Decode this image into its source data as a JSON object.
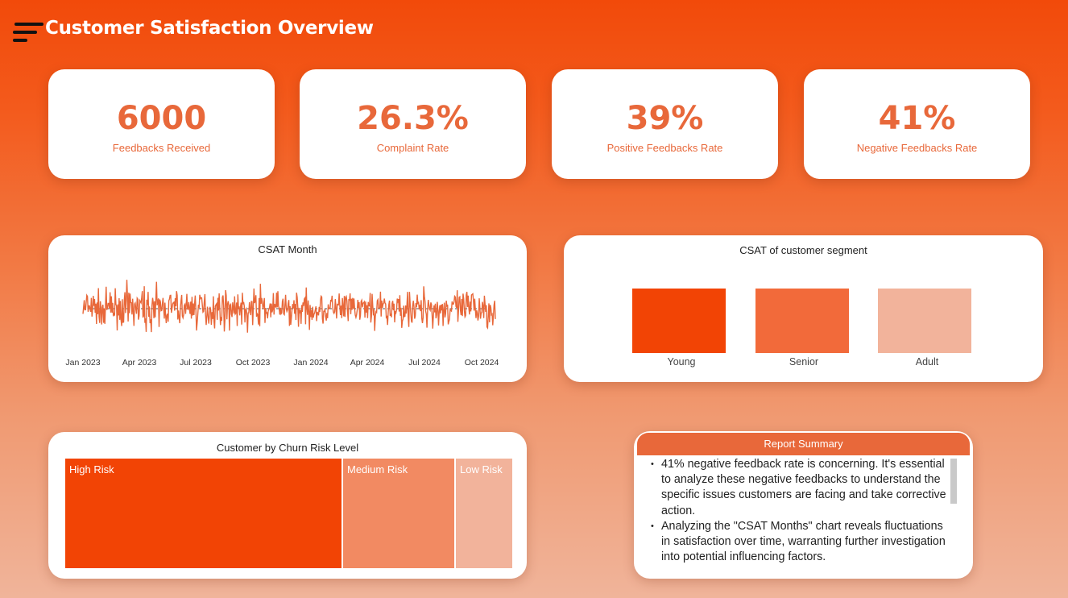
{
  "header": {
    "title": "Customer Satisfaction Overview",
    "menu_icon": "hamburger-menu-icon"
  },
  "kpis": [
    {
      "value": "6000",
      "label": "Feedbacks Received"
    },
    {
      "value": "26.3%",
      "label": "Complaint Rate"
    },
    {
      "value": "39%",
      "label": "Positive Feedbacks Rate"
    },
    {
      "value": "41%",
      "label": "Negative Feedbacks Rate"
    }
  ],
  "csat_month": {
    "title": "CSAT Month",
    "x_ticks": [
      "Jan 2023",
      "Apr 2023",
      "Jul 2023",
      "Oct 2023",
      "Jan 2024",
      "Apr 2024",
      "Jul 2024",
      "Oct 2024"
    ]
  },
  "csat_segment": {
    "title": "CSAT of customer segment",
    "categories": [
      "Young",
      "Senior",
      "Adult"
    ]
  },
  "churn": {
    "title": "Customer by Churn Risk Level",
    "levels": [
      "High Risk",
      "Medium Risk",
      "Low Risk"
    ]
  },
  "summary": {
    "title": "Report Summary",
    "points": [
      "41% negative feedback rate is concerning. It's essential to analyze these negative feedbacks to understand the specific issues customers are facing and take corrective action.",
      "Analyzing the \"CSAT Months\" chart reveals fluctuations in satisfaction over time, warranting further investigation into potential influencing factors."
    ]
  },
  "colors": {
    "accent": "#f24405",
    "accent_mid": "#f26a3a",
    "accent_light": "#f2b39b",
    "kpi_text": "#e8683a"
  },
  "chart_data": [
    {
      "type": "line",
      "title": "CSAT Month",
      "x_range": [
        "2023-01-01",
        "2024-11-15"
      ],
      "series": [
        {
          "values": "daily values fluctuating between low and high around a steady mean (approx. 1,000+ points)"
        }
      ]
    },
    {
      "type": "bar",
      "title": "CSAT of customer segment",
      "categories": [
        "Young",
        "Senior",
        "Adult"
      ],
      "values": [
        1,
        1,
        1
      ]
    },
    {
      "type": "treemap",
      "title": "Customer by Churn Risk Level",
      "categories": [
        "High Risk",
        "Medium Risk",
        "Low Risk"
      ],
      "values": [
        62,
        25,
        13
      ]
    }
  ]
}
